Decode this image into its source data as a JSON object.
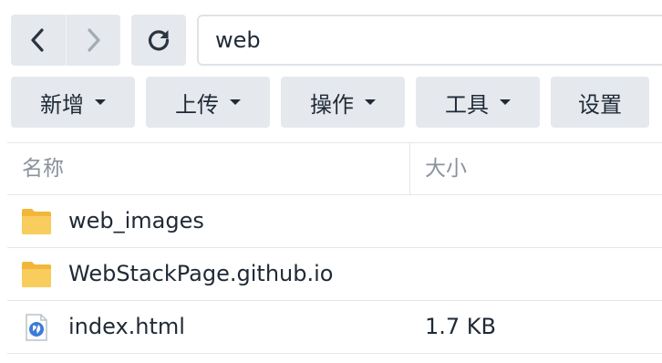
{
  "nav": {
    "back_icon": "chevron-left-icon",
    "forward_icon": "chevron-right-icon",
    "refresh_icon": "refresh-icon"
  },
  "path": {
    "value": "web"
  },
  "toolbar": {
    "new_label": "新增",
    "upload_label": "上传",
    "action_label": "操作",
    "tools_label": "工具",
    "settings_label": "设置"
  },
  "list": {
    "columns": {
      "name": "名称",
      "size": "大小"
    },
    "rows": [
      {
        "name": "web_images",
        "size": "",
        "icon": "folder-icon"
      },
      {
        "name": "WebStackPage.github.io",
        "size": "",
        "icon": "folder-icon"
      },
      {
        "name": "index.html",
        "size": "1.7 KB",
        "icon": "html-file-icon"
      }
    ]
  },
  "colors": {
    "button_bg": "#e5e9ee",
    "text": "#1f2a36",
    "muted_text": "#8a939c",
    "folder": "#f5c451",
    "html_icon": "#3d7bd9"
  }
}
